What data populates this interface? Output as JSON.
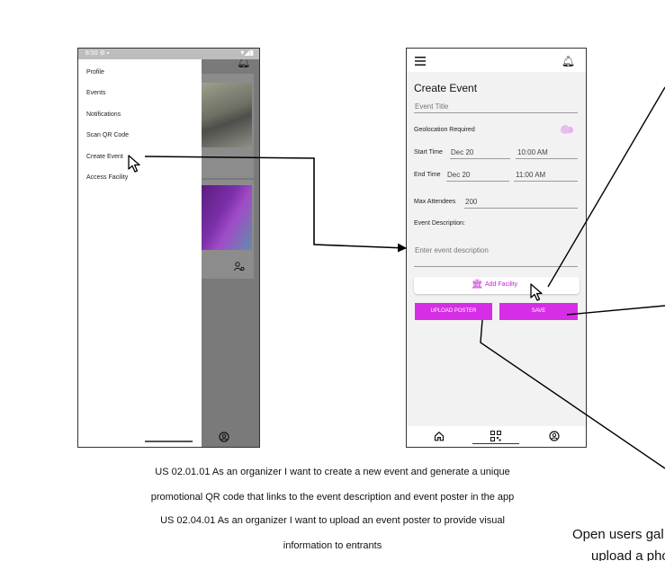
{
  "left_phone": {
    "status_time": "8:50 ⚙ ▪",
    "status_icons": "▾◢▮",
    "drawer": {
      "items": [
        {
          "label": "Profile"
        },
        {
          "label": "Events"
        },
        {
          "label": "Notifications"
        },
        {
          "label": "Scan QR Code"
        },
        {
          "label": "Create Event"
        },
        {
          "label": "Access Facility"
        }
      ]
    },
    "icons": [
      "bell-icon",
      "user-cog-icon",
      "account-icon"
    ]
  },
  "right_phone": {
    "title": "Create Event",
    "event_title_placeholder": "Event Title",
    "geolocation_label": "Geolocation Required",
    "start_time_label": "Start Time",
    "start_date": "Dec 20",
    "start_time": "10:00 AM",
    "end_time_label": "End Time",
    "end_date": "Dec 20",
    "end_time": "11:00 AM",
    "max_attendees_label": "Max Attendees",
    "max_attendees_value": "200",
    "description_label": "Event Description:",
    "description_placeholder": "Enter event description",
    "add_facility_label": "Add Facility",
    "upload_poster_label": "UPLOAD POSTER",
    "save_label": "SAVE",
    "accent_color": "#d62ee6",
    "nav_icons": [
      "home-icon",
      "qr-code-icon",
      "account-icon"
    ]
  },
  "captions": {
    "line1": "US 02.01.01 As an organizer I want to create a new event and generate a unique",
    "line2": "promotional QR code that links to the event description and event poster in the app",
    "line3": "US 02.04.01 As an organizer I want to upload an event poster to provide visual",
    "line4": "information to entrants"
  },
  "side_note": {
    "line1": "Open users gal",
    "line2": "upload a pho"
  }
}
